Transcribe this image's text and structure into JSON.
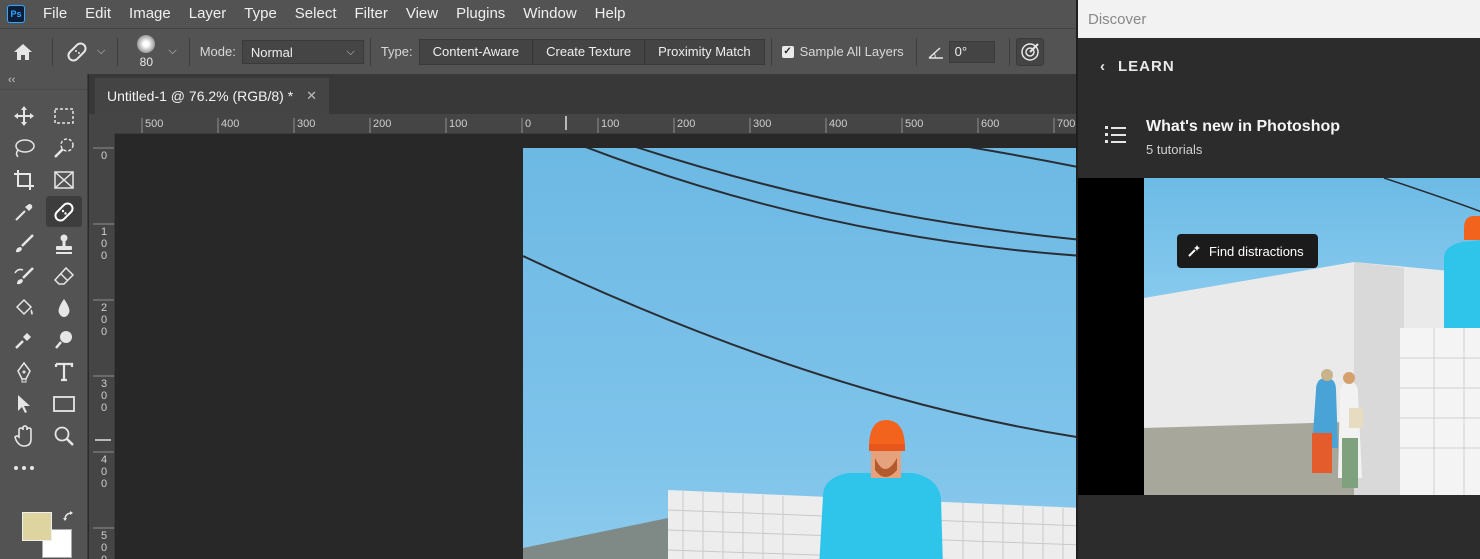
{
  "app": {
    "logo_text": "Ps"
  },
  "menu": [
    "File",
    "Edit",
    "Image",
    "Layer",
    "Type",
    "Select",
    "Filter",
    "View",
    "Plugins",
    "Window",
    "Help"
  ],
  "options": {
    "brush_size": "80",
    "mode_label": "Mode:",
    "mode_value": "Normal",
    "type_label": "Type:",
    "type_buttons": [
      "Content-Aware",
      "Create Texture",
      "Proximity Match"
    ],
    "sample_all_layers": "Sample All Layers",
    "angle_value": "0°"
  },
  "document": {
    "tab_title": "Untitled-1 @ 76.2% (RGB/8) *",
    "ruler_top": [
      "500",
      "400",
      "300",
      "200",
      "100",
      "0",
      "100",
      "200",
      "300",
      "400",
      "500",
      "600",
      "700"
    ],
    "ruler_left": [
      [
        "0"
      ],
      [
        "1",
        "0",
        "0"
      ],
      [
        "2",
        "0",
        "0"
      ],
      [
        "3",
        "0",
        "0"
      ],
      [
        "4",
        "0",
        "0"
      ],
      [
        "5",
        "0",
        "0"
      ]
    ]
  },
  "colors": {
    "foreground": "#ddd4a0",
    "background": "#ffffff",
    "ui_panel": "#535353",
    "canvas": "#282828",
    "sky": "#7ec3ea"
  },
  "tools": [
    "move-icon",
    "marquee-icon",
    "lasso-icon",
    "quick-select-icon",
    "crop-icon",
    "frame-icon",
    "eyedropper-icon",
    "spot-healing-icon",
    "brush-icon",
    "stamp-icon",
    "history-brush-icon",
    "eraser-icon",
    "paint-bucket-icon",
    "blur-icon",
    "dodge-icon",
    "smudge-icon",
    "pen-icon",
    "type-icon",
    "path-select-icon",
    "rectangle-icon",
    "hand-icon",
    "zoom-icon",
    "more-tools-icon"
  ],
  "discover": {
    "title": "Discover",
    "back_label": "LEARN",
    "section_title": "What's new in Photoshop",
    "section_subtitle": "5 tutorials",
    "pill_label": "Find distractions"
  }
}
